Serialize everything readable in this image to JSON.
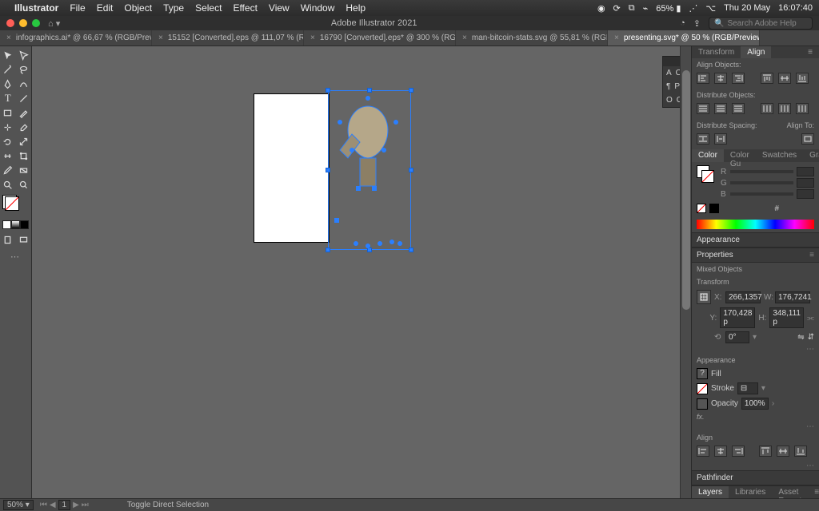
{
  "menubar": {
    "app": "Illustrator",
    "items": [
      "File",
      "Edit",
      "Object",
      "Type",
      "Select",
      "Effect",
      "View",
      "Window",
      "Help"
    ],
    "battery": "65%",
    "date": "Thu 20 May",
    "time": "16:07:40"
  },
  "titlebar": {
    "title": "Adobe Illustrator 2021",
    "search_ph": "Search Adobe Help"
  },
  "tabs": [
    {
      "label": "infographics.ai* @ 66,67 % (RGB/Previ…",
      "active": false
    },
    {
      "label": "15152 [Converted].eps @ 111,07 % (RGB/Previ…",
      "active": false
    },
    {
      "label": "16790 [Converted].eps* @ 300 % (RGB/Previe…",
      "active": false
    },
    {
      "label": "man-bitcoin-stats.svg @ 55,81 % (RGB/Previ…",
      "active": false
    },
    {
      "label": "presenting.svg* @ 50 % (RGB/Preview)",
      "active": true
    }
  ],
  "floating": {
    "items": [
      {
        "icon": "A",
        "label": "Character"
      },
      {
        "icon": "¶",
        "label": "Paragraph"
      },
      {
        "icon": "O",
        "label": "OpenType"
      }
    ]
  },
  "right": {
    "top_tabs": [
      "Transform",
      "Align"
    ],
    "align_objects": "Align Objects:",
    "distribute_objects": "Distribute Objects:",
    "distribute_spacing": "Distribute Spacing:",
    "align_to": "Align To:",
    "color_tabs": [
      "Color",
      "Color Gu",
      "Swatches",
      "Gradient"
    ],
    "color_channels": [
      "R",
      "G",
      "B"
    ],
    "hex_label": "#",
    "appearance": "Appearance",
    "properties": "Properties",
    "mixed": "Mixed Objects",
    "transform": "Transform",
    "x_lbl": "X:",
    "y_lbl": "Y:",
    "w_lbl": "W:",
    "h_lbl": "H:",
    "x": "266,1357",
    "y": "170,428 p",
    "w": "176,7241",
    "h": "348,111 p",
    "rotate": "0°",
    "appearance2": "Appearance",
    "fill": "Fill",
    "stroke": "Stroke",
    "opacity_lbl": "Opacity",
    "opacity": "100%",
    "fx": "fx.",
    "align2": "Align",
    "pathfinder": "Pathfinder"
  },
  "bottom_tabs": [
    "Layers",
    "Libraries",
    "Asset Export"
  ],
  "statusbar": {
    "zoom": "50%",
    "artboard": "1",
    "tool": "Toggle Direct Selection"
  }
}
